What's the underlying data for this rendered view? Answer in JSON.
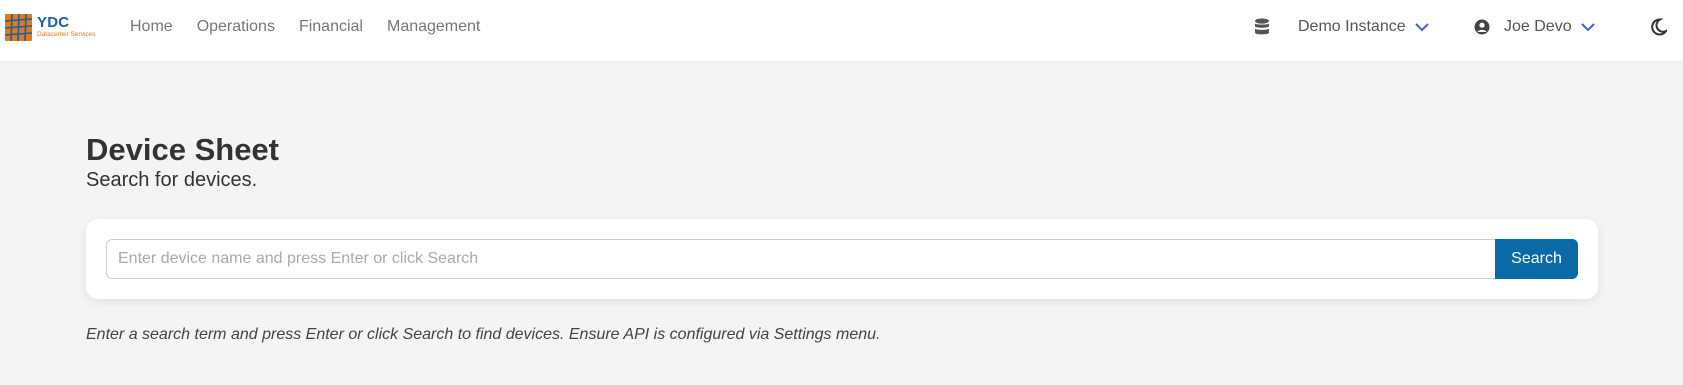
{
  "brand": {
    "name": "YDC",
    "subtitle": "Datacenter Services",
    "colors": {
      "blue": "#1a5fa8",
      "orange": "#e07a1f"
    }
  },
  "nav": {
    "links": [
      "Home",
      "Operations",
      "Financial",
      "Management"
    ]
  },
  "navbar_right": {
    "database_icon": "database-icon",
    "instance_label": "Demo Instance",
    "user_icon": "user-circle-icon",
    "user_name": "Joe Devo",
    "theme_icon": "moon-icon",
    "chevron_color": "#4a5fd6"
  },
  "page": {
    "title": "Device Sheet",
    "subtitle": "Search for devices."
  },
  "search": {
    "placeholder": "Enter device name and press Enter or click Search",
    "value": "",
    "button_label": "Search",
    "button_color": "#0a6aa6"
  },
  "help_text": "Enter a search term and press Enter or click Search to find devices. Ensure API is configured via Settings menu."
}
